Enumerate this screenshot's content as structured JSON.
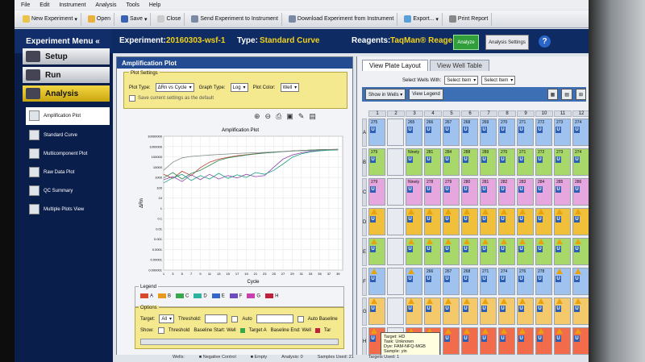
{
  "menubar": {
    "items": [
      "File",
      "Edit",
      "Instrument",
      "Analysis",
      "Tools",
      "Help"
    ]
  },
  "toolbar": {
    "new_experiment": "New Experiment",
    "open": "Open",
    "save": "Save",
    "close": "Close",
    "send": "Send Experiment to Instrument",
    "download": "Download Experiment from Instrument",
    "export": "Export...",
    "print": "Print Report"
  },
  "header": {
    "menu_title": "Experiment Menu «",
    "experiment_label": "Experiment:",
    "experiment_name": "20160303-wsf-1",
    "type_label": "Type:",
    "type_value": "Standard Curve",
    "reagents_label": "Reagents:",
    "reagents_value": "TaqMan® Reagents",
    "analyze": "Analyze",
    "analysis_settings": "Analysis Settings",
    "help": "?"
  },
  "sidebar": {
    "nav": [
      "Setup",
      "Run",
      "Analysis"
    ],
    "items": [
      "Amplification Plot",
      "Standard Curve",
      "Multicomponent Plot",
      "Raw Data Plot",
      "QC Summary",
      "Multiple Plots View"
    ]
  },
  "amp": {
    "title": "Amplification Plot",
    "settings_title": "Plot Settings",
    "plot_type_label": "Plot Type:",
    "plot_type_value": "ΔRn vs Cycle",
    "graph_type_label": "Graph Type:",
    "graph_type_value": "Log",
    "plot_color_label": "Plot Color:",
    "plot_color_value": "Well",
    "save_default": "Save current settings as the default",
    "legend_title": "Legend",
    "options_title": "Options",
    "target_label": "Target:",
    "target_value": "All",
    "threshold_label": "Threshold:",
    "auto_label": "Auto",
    "auto_baseline": "Auto Baseline",
    "show_label": "Show:",
    "show_threshold": "Threshold",
    "baseline_start": "Baseline Start: Well",
    "target_a": "Target A",
    "baseline_end": "Baseline End: Well",
    "target_b": "Tar"
  },
  "chart_data": {
    "type": "line",
    "title": "Amplification Plot",
    "xlabel": "Cycle",
    "ylabel": "ΔRn",
    "y_scale": "log",
    "y_ticks": [
      "10000000",
      "1000000",
      "100000",
      "10000",
      "1000",
      "100",
      "10",
      "1",
      "0.1",
      "0.01",
      "0.001",
      "0.0001",
      "0.00001",
      "0.000001"
    ],
    "x_ticks": [
      "1",
      "3",
      "5",
      "7",
      "9",
      "11",
      "13",
      "15",
      "17",
      "19",
      "21",
      "23",
      "25",
      "27",
      "29",
      "31",
      "33",
      "35",
      "37",
      "39"
    ],
    "xlim": [
      1,
      40
    ],
    "ylim": [
      1e-06,
      10000000
    ],
    "series": [
      {
        "color": "#c0392b",
        "x": [
          1,
          3,
          5,
          7,
          9,
          11,
          13,
          15,
          17,
          19,
          21,
          23,
          25,
          27,
          29,
          31,
          33,
          35,
          37,
          39
        ],
        "y": [
          2000,
          800,
          4000,
          1500,
          9000,
          30000,
          60000,
          90000,
          130000,
          160000,
          200000,
          240000,
          280000,
          330000,
          380000,
          420000,
          460000,
          500000,
          520000,
          540000
        ]
      },
      {
        "color": "#2e8b57",
        "x": [
          1,
          3,
          5,
          7,
          9,
          11,
          13,
          15,
          17,
          19,
          21,
          23,
          25,
          27,
          29,
          31,
          33,
          35,
          37,
          39
        ],
        "y": [
          900,
          3000,
          700,
          2500,
          5000,
          15000,
          45000,
          80000,
          110000,
          150000,
          190000,
          230000,
          270000,
          320000,
          370000,
          410000,
          450000,
          490000,
          510000,
          530000
        ]
      },
      {
        "color": "#8e44ad",
        "x": [
          1,
          3,
          5,
          7,
          9,
          11,
          13,
          15,
          17,
          19,
          21,
          23,
          25,
          27,
          29,
          31,
          33,
          35,
          37,
          39
        ],
        "y": [
          600,
          1200,
          400,
          1800,
          600,
          2000,
          700,
          1500,
          900,
          2000,
          1200,
          1500,
          10000,
          60000,
          150000,
          250000,
          350000,
          420000,
          470000,
          500000
        ]
      },
      {
        "color": "#16a085",
        "x": [
          1,
          3,
          5,
          7,
          9,
          11,
          13,
          15,
          17,
          19,
          21,
          23,
          25,
          27,
          29,
          31,
          33,
          35,
          37,
          39
        ],
        "y": [
          300,
          900,
          2000,
          500,
          1500,
          700,
          2500,
          800,
          1800,
          1000,
          3000,
          2000,
          5000,
          20000,
          90000,
          200000,
          300000,
          380000,
          430000,
          470000
        ]
      },
      {
        "color": "#7f8c8d",
        "x": [
          1,
          3,
          5,
          7,
          9,
          11,
          13,
          15,
          17,
          19,
          21,
          23,
          25,
          27,
          29,
          31,
          33,
          35,
          37,
          39
        ],
        "y": [
          5000,
          30000,
          80000,
          110000,
          130000,
          150000,
          170000,
          190000,
          210000,
          230000,
          250000,
          270000,
          300000,
          330000,
          360000,
          390000,
          420000,
          450000,
          480000,
          500000
        ]
      }
    ]
  },
  "legend": [
    {
      "label": "A",
      "color": "#d9482b"
    },
    {
      "label": "B",
      "color": "#e79a1f"
    },
    {
      "label": "C",
      "color": "#3aa84a"
    },
    {
      "label": "D",
      "color": "#2fb3a0"
    },
    {
      "label": "E",
      "color": "#3467c9"
    },
    {
      "label": "F",
      "color": "#6d4bc2"
    },
    {
      "label": "G",
      "color": "#c83fb0"
    },
    {
      "label": "H",
      "color": "#c0203a"
    }
  ],
  "wells": {
    "tab_layout": "View Plate Layout",
    "tab_table": "View Well Table",
    "select_label": "Select Wells With:",
    "select_item": "Select Item",
    "select_item2": "Select Item",
    "show_in_wells": "Show in Wells ▾",
    "view_legend": "View Legend",
    "columns": [
      "1",
      "2",
      "3",
      "4",
      "5",
      "6",
      "7",
      "8",
      "9",
      "10",
      "11",
      "12"
    ],
    "rows": [
      "A",
      "B",
      "C",
      "D",
      "E",
      "F",
      "G",
      "H"
    ],
    "row_colors": [
      "#9fc2ee",
      "#a9d86a",
      "#e6a6de",
      "#f0c03a",
      "#a9d86a",
      "#9fc2ee",
      "#f4c96b",
      "#f26b4a"
    ],
    "numbers": [
      [
        "275",
        "",
        "265",
        "266",
        "267",
        "268",
        "269",
        "270",
        "271",
        "272",
        "273",
        "274"
      ],
      [
        "279",
        "",
        "Ninety",
        "281",
        "284",
        "288",
        "289",
        "270",
        "271",
        "272",
        "273",
        "274"
      ],
      [
        "279",
        "",
        "Ninety",
        "278",
        "279",
        "280",
        "281",
        "282",
        "283",
        "284",
        "285",
        "286"
      ],
      [
        "",
        "",
        "",
        "",
        "",
        "",
        "",
        "",
        "",
        "",
        "",
        ""
      ],
      [
        "",
        "",
        "",
        "",
        "",
        "",
        "",
        "",
        "",
        "",
        "",
        ""
      ],
      [
        "",
        "",
        "",
        "266",
        "267",
        "268",
        "271",
        "274",
        "276",
        "278",
        "",
        ""
      ],
      [
        "",
        "",
        "",
        "",
        "",
        "",
        "",
        "",
        "",
        "",
        "",
        ""
      ],
      [
        "",
        "",
        "",
        "",
        "",
        "",
        "",
        "",
        "",
        "",
        "",
        ""
      ]
    ]
  },
  "tooltip": {
    "target": "Target: HD",
    "task": "Task: Unknown",
    "dye": "Dye: FAM-NFQ-MGB",
    "sample": "Sample: yin"
  },
  "status": {
    "wells": "Wells:",
    "neg": "■ Negative Control",
    "empty": "■ Empty",
    "analysis": "Analysis: 0",
    "samples": "Samples Used: 21",
    "targets": "Targets Used: 1"
  }
}
